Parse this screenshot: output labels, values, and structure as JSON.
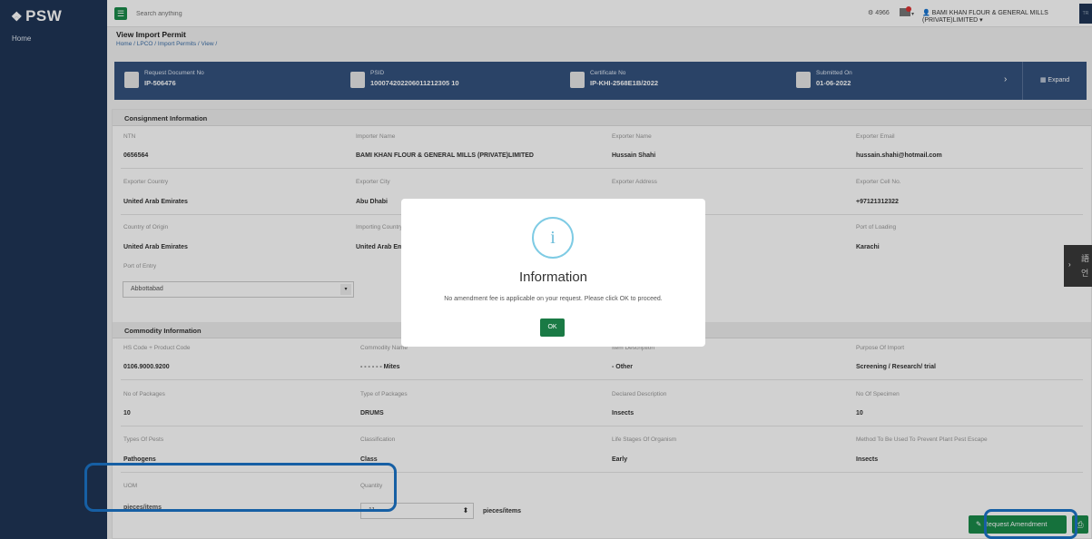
{
  "app": {
    "logo": "PSW",
    "logo_mark": "❖"
  },
  "sidebar": {
    "home": "Home"
  },
  "topbar": {
    "search_placeholder": "Search anything",
    "notif_count": "4966",
    "user": "BAMI KHAN FLOUR & GENERAL MILLS (PRIVATE)LIMITED",
    "right_btn": "TR"
  },
  "page": {
    "title": "View Import Permit",
    "breadcrumb": "Home / LPCO / Import Permits / View /"
  },
  "docbar": {
    "cards": [
      {
        "label": "Request Document No",
        "value": "IP-506476"
      },
      {
        "label": "PSID",
        "value": "100074202206011212305 10"
      },
      {
        "label": "Certificate No",
        "value": "IP-KHI-2568E1B/2022"
      },
      {
        "label": "Submitted On",
        "value": "01-06-2022"
      }
    ],
    "expand": "Expand"
  },
  "consignment": {
    "heading": "Consignment Information",
    "fields": [
      {
        "label": "NTN",
        "value": "0656564"
      },
      {
        "label": "Importer Name",
        "value": "BAMI KHAN FLOUR & GENERAL MILLS (PRIVATE)LIMITED"
      },
      {
        "label": "Exporter Name",
        "value": "Hussain Shahi"
      },
      {
        "label": "Exporter Email",
        "value": "hussain.shahi@hotmail.com"
      },
      {
        "label": "Exporter Country",
        "value": "United Arab Emirates"
      },
      {
        "label": "Exporter City",
        "value": "Abu Dhabi"
      },
      {
        "label": "Exporter Address",
        "value": ""
      },
      {
        "label": "Exporter Cell No.",
        "value": "+97121312322"
      },
      {
        "label": "Country of Origin",
        "value": "United Arab Emirates"
      },
      {
        "label": "Importing Country",
        "value": "United Arab Emirates"
      },
      {
        "label": "",
        "value": ""
      },
      {
        "label": "Port of Loading",
        "value": "Karachi"
      }
    ],
    "port_of_entry_label": "Port of Entry",
    "port_of_entry_value": "Abbottabad"
  },
  "commodity": {
    "heading": "Commodity Information",
    "fields": [
      {
        "label": "HS Code + Product Code",
        "value": "0106.9000.9200"
      },
      {
        "label": "Commodity Name",
        "value": "- - - - - - Mites"
      },
      {
        "label": "Item Description",
        "value": "- Other"
      },
      {
        "label": "Purpose Of Import",
        "value": "Screening / Research/ trial"
      },
      {
        "label": "No of Packages",
        "value": "10"
      },
      {
        "label": "Type of Packages",
        "value": "DRUMS"
      },
      {
        "label": "Declared Description",
        "value": "Insects"
      },
      {
        "label": "No Of Specimen",
        "value": "10"
      },
      {
        "label": "Types Of Pests",
        "value": "Pathogens"
      },
      {
        "label": "Classification",
        "value": "Class"
      },
      {
        "label": "Life Stages Of Organism",
        "value": "Early"
      },
      {
        "label": "Method To Be Used To Prevent Plant Pest Escape",
        "value": "Insects"
      }
    ],
    "uom_label": "UOM",
    "uom_value": "pieces/items",
    "qty_label": "Quantity",
    "qty_value": "11",
    "qty_unit": "pieces/items"
  },
  "actions": {
    "request_amendment": "Request Amendment"
  },
  "side_tab": {
    "text": "語\n언"
  },
  "modal": {
    "title": "Information",
    "message": "No amendment fee is applicable on your request. Please click OK to proceed.",
    "ok": "OK",
    "icon": "i"
  }
}
